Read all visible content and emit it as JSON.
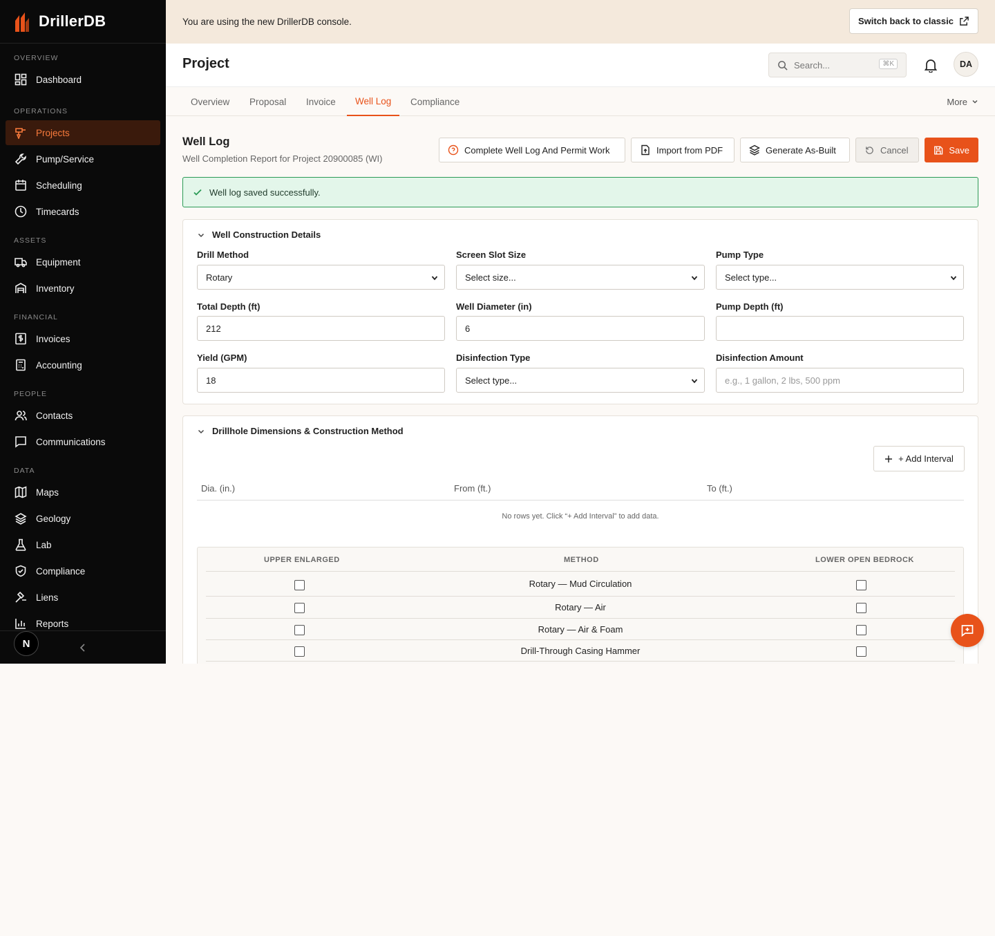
{
  "brand": {
    "name": "DrillerDB"
  },
  "sidebar": {
    "sections": [
      {
        "label": "OVERVIEW",
        "items": [
          {
            "label": "Dashboard",
            "icon": "dashboard-icon"
          }
        ]
      },
      {
        "label": "OPERATIONS",
        "items": [
          {
            "label": "Projects",
            "icon": "drill-icon",
            "active": true
          },
          {
            "label": "Pump/Service",
            "icon": "wrench-icon"
          },
          {
            "label": "Scheduling",
            "icon": "calendar-icon"
          },
          {
            "label": "Timecards",
            "icon": "clock-icon"
          }
        ]
      },
      {
        "label": "ASSETS",
        "items": [
          {
            "label": "Equipment",
            "icon": "truck-icon"
          },
          {
            "label": "Inventory",
            "icon": "warehouse-icon"
          }
        ]
      },
      {
        "label": "FINANCIAL",
        "items": [
          {
            "label": "Invoices",
            "icon": "invoice-icon"
          },
          {
            "label": "Accounting",
            "icon": "calculator-icon"
          }
        ]
      },
      {
        "label": "PEOPLE",
        "items": [
          {
            "label": "Contacts",
            "icon": "users-icon"
          },
          {
            "label": "Communications",
            "icon": "message-icon"
          }
        ]
      },
      {
        "label": "DATA",
        "items": [
          {
            "label": "Maps",
            "icon": "map-icon"
          },
          {
            "label": "Geology",
            "icon": "layers-icon"
          },
          {
            "label": "Lab",
            "icon": "flask-icon"
          },
          {
            "label": "Compliance",
            "icon": "shield-icon"
          },
          {
            "label": "Liens",
            "icon": "gavel-icon"
          },
          {
            "label": "Reports",
            "icon": "bar-chart-icon"
          }
        ]
      }
    ],
    "footer_badge": "N"
  },
  "banner": {
    "text": "You are using the new DrillerDB console.",
    "switch_label": "Switch back to classic"
  },
  "header": {
    "title": "Project",
    "search_placeholder": "Search...",
    "search_shortcut": "⌘K",
    "avatar": "DA"
  },
  "tabs": {
    "items": [
      "Overview",
      "Proposal",
      "Invoice",
      "Well Log",
      "Compliance"
    ],
    "active": "Well Log",
    "more_label": "More"
  },
  "page": {
    "title": "Well Log",
    "subtitle": "Well Completion Report for Project 20900085 (WI)",
    "actions": {
      "complete": "Complete Well Log And Permit Work",
      "import": "Import from PDF",
      "generate": "Generate As-Built",
      "cancel": "Cancel",
      "save": "Save"
    },
    "alert": "Well log saved successfully."
  },
  "construction": {
    "title": "Well Construction Details",
    "fields": {
      "drill_method": {
        "label": "Drill Method",
        "value": "Rotary"
      },
      "screen_slot": {
        "label": "Screen Slot Size",
        "value": "Select size..."
      },
      "pump_type": {
        "label": "Pump Type",
        "value": "Select type..."
      },
      "total_depth": {
        "label": "Total Depth (ft)",
        "value": "212"
      },
      "well_diameter": {
        "label": "Well Diameter (in)",
        "value": "6"
      },
      "pump_depth": {
        "label": "Pump Depth (ft)",
        "value": ""
      },
      "yield": {
        "label": "Yield (GPM)",
        "value": "18"
      },
      "disinfection_type": {
        "label": "Disinfection Type",
        "value": "Select type..."
      },
      "disinfection_amount": {
        "label": "Disinfection Amount",
        "placeholder": "e.g., 1 gallon, 2 lbs, 500 ppm"
      }
    }
  },
  "drillhole": {
    "title": "Drillhole Dimensions & Construction Method",
    "add_label": "+ Add Interval",
    "columns": [
      "Dia. (in.)",
      "From (ft.)",
      "To (ft.)"
    ],
    "empty_text": "No rows yet. Click “+ Add Interval” to add data.",
    "method_table": {
      "headers": [
        "UPPER ENLARGED",
        "METHOD",
        "LOWER OPEN BEDROCK"
      ],
      "rows": [
        {
          "method": "Rotary — Mud Circulation",
          "upper": false,
          "lower": false
        },
        {
          "method": "Rotary — Air",
          "upper": false,
          "lower": false
        },
        {
          "method": "Rotary — Air & Foam",
          "upper": false,
          "lower": false
        },
        {
          "method": "Drill-Through Casing Hammer",
          "upper": false,
          "lower": false
        }
      ]
    }
  },
  "colors": {
    "accent": "#e8521a",
    "sidebar_bg": "#0a0a0a",
    "banner_bg": "#f4e9dc",
    "success_border": "#2a9a55"
  }
}
